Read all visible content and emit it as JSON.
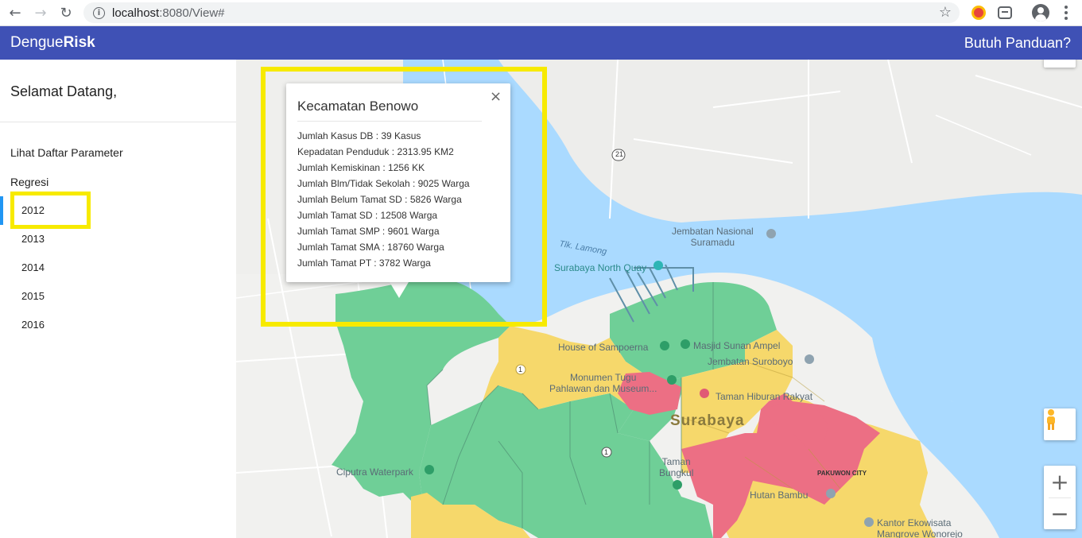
{
  "browser": {
    "url_host": "localhost",
    "url_path": ":8080/View#"
  },
  "appbar": {
    "brand_light": "Dengue",
    "brand_bold": "Risk",
    "help": "Butuh Panduan?",
    "color": "#3f51b5"
  },
  "sidebar": {
    "welcome": "Selamat Datang,",
    "param_link": "Lihat Daftar Parameter",
    "section": "Regresi",
    "years": [
      "2012",
      "2013",
      "2014",
      "2015",
      "2016"
    ],
    "selected_year": "2012"
  },
  "map": {
    "labels": {
      "jembatan": "Jembatan Nasional\nSuramadu",
      "lamong": "Tlk. Lamong",
      "north_quay": "Surabaya North Quay",
      "sampoerna": "House of Sampoerna",
      "sunan": "Masjid Sunan Ampel",
      "suroboyo": "Jembatan Suroboyo",
      "tugu": "Monumen Tugu\nPahlawan dan Museum...",
      "hiburan": "Taman Hiburan Rakyat",
      "surabaya": "Surabaya",
      "ciputra": "Ciputra Waterpark",
      "bungkul": "Taman\nBungkul",
      "pakuwon": "PAKUWON CITY",
      "bambu": "Hutan Bambu",
      "kantor": "Kantor Ekowisata\nMangrove Wonorejo",
      "road21": "21",
      "road1a": "1",
      "road1b": "1"
    },
    "risk_colors": {
      "low": "#6fcf97",
      "medium": "#f6d86b",
      "high": "#ec6f84"
    }
  },
  "infowindow": {
    "title": "Kecamatan Benowo",
    "close": "×",
    "rows": [
      "Jumlah Kasus DB : 39 Kasus",
      "Kepadatan Penduduk : 2313.95 KM2",
      "Jumlah Kemiskinan : 1256 KK",
      "Jumlah Blm/Tidak Sekolah : 9025 Warga",
      "Jumlah Belum Tamat SD : 5826 Warga",
      "Jumlah Tamat SD : 12508 Warga",
      "Jumlah Tamat SMP : 9601 Warga",
      "Jumlah Tamat SMA : 18760 Warga",
      "Jumlah Tamat PT : 3782 Warga"
    ]
  },
  "highlight_color": "#f7ea00"
}
